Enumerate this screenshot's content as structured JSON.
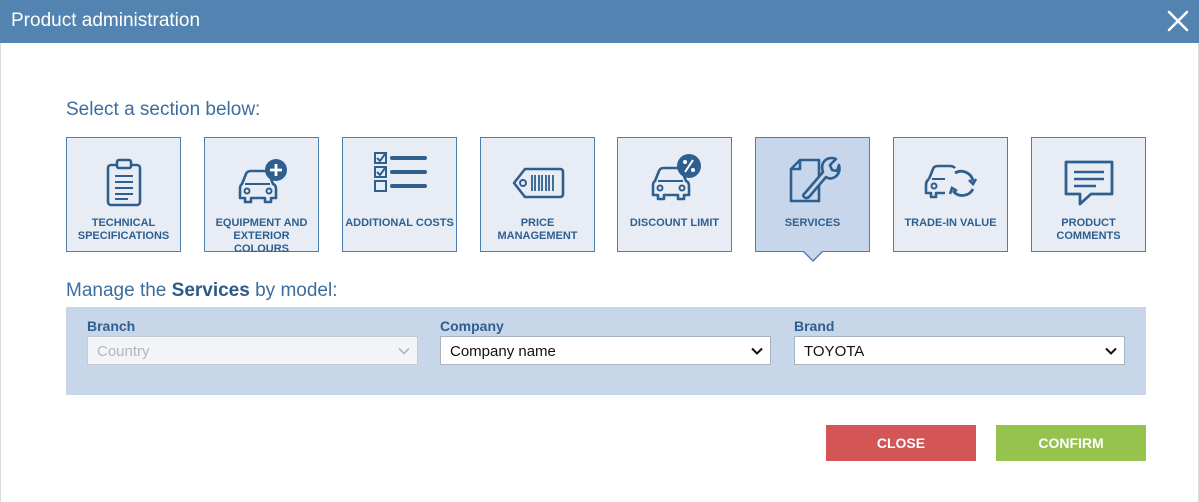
{
  "dialog": {
    "title": "Product administration",
    "close_icon": "close-icon"
  },
  "sections": {
    "heading": "Select a section below:",
    "tiles": [
      {
        "label": "TECHNICAL SPECIFICATIONS",
        "icon": "clipboard-icon",
        "active": false
      },
      {
        "label": "EQUIPMENT AND EXTERIOR COLOURS",
        "icon": "car-plus-icon",
        "active": false
      },
      {
        "label": "ADDITIONAL COSTS",
        "icon": "checklist-icon",
        "active": false
      },
      {
        "label": "PRICE MANAGEMENT",
        "icon": "price-tag-icon",
        "active": false
      },
      {
        "label": "DISCOUNT LIMIT",
        "icon": "car-percent-icon",
        "active": false
      },
      {
        "label": "SERVICES",
        "icon": "wrench-document-icon",
        "active": true
      },
      {
        "label": "TRADE-IN VALUE",
        "icon": "car-cycle-icon",
        "active": false
      },
      {
        "label": "PRODUCT COMMENTS",
        "icon": "comment-icon",
        "active": false
      }
    ]
  },
  "manage": {
    "prefix": "Manage the ",
    "section": "Services",
    "suffix": " by model:"
  },
  "filters": {
    "branch": {
      "label": "Branch",
      "value": "Country",
      "disabled": true
    },
    "company": {
      "label": "Company",
      "value": "Company name"
    },
    "brand": {
      "label": "Brand",
      "value": "TOYOTA"
    }
  },
  "buttons": {
    "close": "CLOSE",
    "confirm": "CONFIRM"
  },
  "colors": {
    "titlebar": "#5383b1",
    "accent": "#4d7fae",
    "tile_bg": "#e8edf5",
    "tile_active_bg": "#c7d6ea",
    "panel_bg": "#c8d6ea",
    "close_button": "#d35555",
    "confirm_button": "#95c34e"
  }
}
